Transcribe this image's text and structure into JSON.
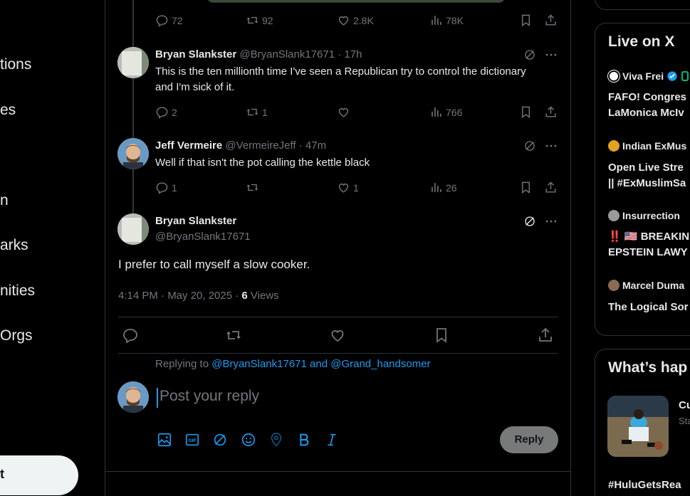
{
  "nav": {
    "items": [
      "tions",
      "es",
      "",
      "n",
      "arks",
      "nities",
      " Orgs"
    ],
    "post_label": "t"
  },
  "thread": {
    "first_actions": {
      "replies": "72",
      "reposts": "92",
      "likes": "2.8K",
      "views": "78K"
    },
    "replies": [
      {
        "name": "Bryan Slankster",
        "handle": "@BryanSlank17671",
        "time": "· 17h",
        "text": "This is the ten millionth time I've seen a Republican try to control the dictionary and I'm sick of it.",
        "replies": "2",
        "reposts": "1",
        "likes": "",
        "views": "766"
      },
      {
        "name": "Jeff Vermeire",
        "handle": "@VermeireJeff",
        "time": "· 47m",
        "text": "Well if that isn't the pot calling the kettle black",
        "replies": "1",
        "reposts": "",
        "likes": "1",
        "views": "26"
      }
    ]
  },
  "focused": {
    "name": "Bryan Slankster",
    "handle": "@BryanSlank17671",
    "text": "I prefer to call myself a slow cooker.",
    "timestamp": "4:14 PM · May 20, 2025 · ",
    "views_count": "6",
    "views_label": " Views"
  },
  "composer": {
    "replying_prefix": "Replying to ",
    "replying_to": "@BryanSlank17671 and @Grand_handsomer",
    "placeholder": "Post your reply",
    "reply_label": "Reply"
  },
  "right": {
    "live_title": "Live on X",
    "live": [
      {
        "name": "Viva Frei",
        "title_lines": [
          "FAFO! Congres",
          "LaMonica McIv"
        ]
      },
      {
        "name": "Indian ExMus",
        "title_lines": [
          "Open Live Stre",
          "|| #ExMuslimSa"
        ]
      },
      {
        "name": "Insurrection",
        "title_lines": [
          "‼️ 🇺🇸 BREAKIN",
          "EPSTEIN LAWY"
        ]
      },
      {
        "name": "Marcel Duma",
        "title_lines": [
          "The Logical Sor"
        ]
      }
    ],
    "whats_title": "What’s hap",
    "trend_text_1": "Cu",
    "trend_text_2": "Sta",
    "hashtag": "#HuluGetsRea"
  },
  "colors": {
    "accent": "#1d9bf0",
    "muted": "#71767b",
    "text": "#e7e9ea",
    "border": "#2f3336"
  }
}
